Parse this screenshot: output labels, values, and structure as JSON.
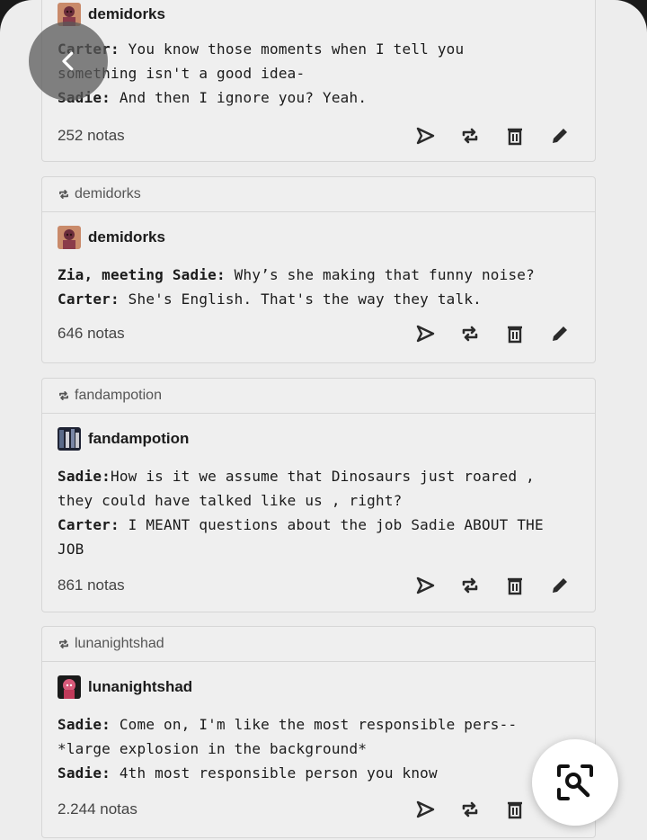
{
  "posts": [
    {
      "reblog_from": "",
      "username": "demidorks",
      "lines": [
        {
          "speaker": "Carter:",
          "text": " You know those moments when I tell you"
        },
        {
          "speaker": "",
          "text": "something isn't a good idea-"
        },
        {
          "speaker": "Sadie:",
          "text": " And then I ignore you? Yeah."
        }
      ],
      "notes": "252 notas"
    },
    {
      "reblog_from": "demidorks",
      "username": "demidorks",
      "lines": [
        {
          "speaker": "Zia, meeting Sadie:",
          "text": " Why’s she making that funny noise?"
        },
        {
          "speaker": "Carter:",
          "text": " She's English. That's the way they talk."
        }
      ],
      "notes": "646 notas"
    },
    {
      "reblog_from": "fandampotion",
      "username": "fandampotion",
      "lines": [
        {
          "speaker": "Sadie:",
          "text": "How is it we assume that Dinosaurs just roared ,"
        },
        {
          "speaker": "",
          "text": "they could have talked like us , right?"
        },
        {
          "speaker": "Carter:",
          "text": " I MEANT questions about the job Sadie ABOUT THE"
        },
        {
          "speaker": "",
          "text": "JOB"
        }
      ],
      "notes": "861 notas"
    },
    {
      "reblog_from": "lunanightshad",
      "username": "lunanightshad",
      "lines": [
        {
          "speaker": "Sadie:",
          "text": " Come on, I'm like the most responsible pers--"
        },
        {
          "speaker": "",
          "text": "*large explosion in the background*"
        },
        {
          "speaker": "Sadie:",
          "text": " 4th most responsible person you know"
        }
      ],
      "notes": "2.244 notas"
    }
  ],
  "icons": {
    "share": "paper-plane-icon",
    "reblog": "reblog-icon",
    "delete": "trash-icon",
    "edit": "pencil-icon",
    "back": "chevron-left-icon",
    "lens": "image-search-icon"
  },
  "colors": {
    "background": "#ededed",
    "card": "#efefef",
    "border": "#d6d6d6",
    "text": "#1b1b1b",
    "muted": "#555555"
  }
}
